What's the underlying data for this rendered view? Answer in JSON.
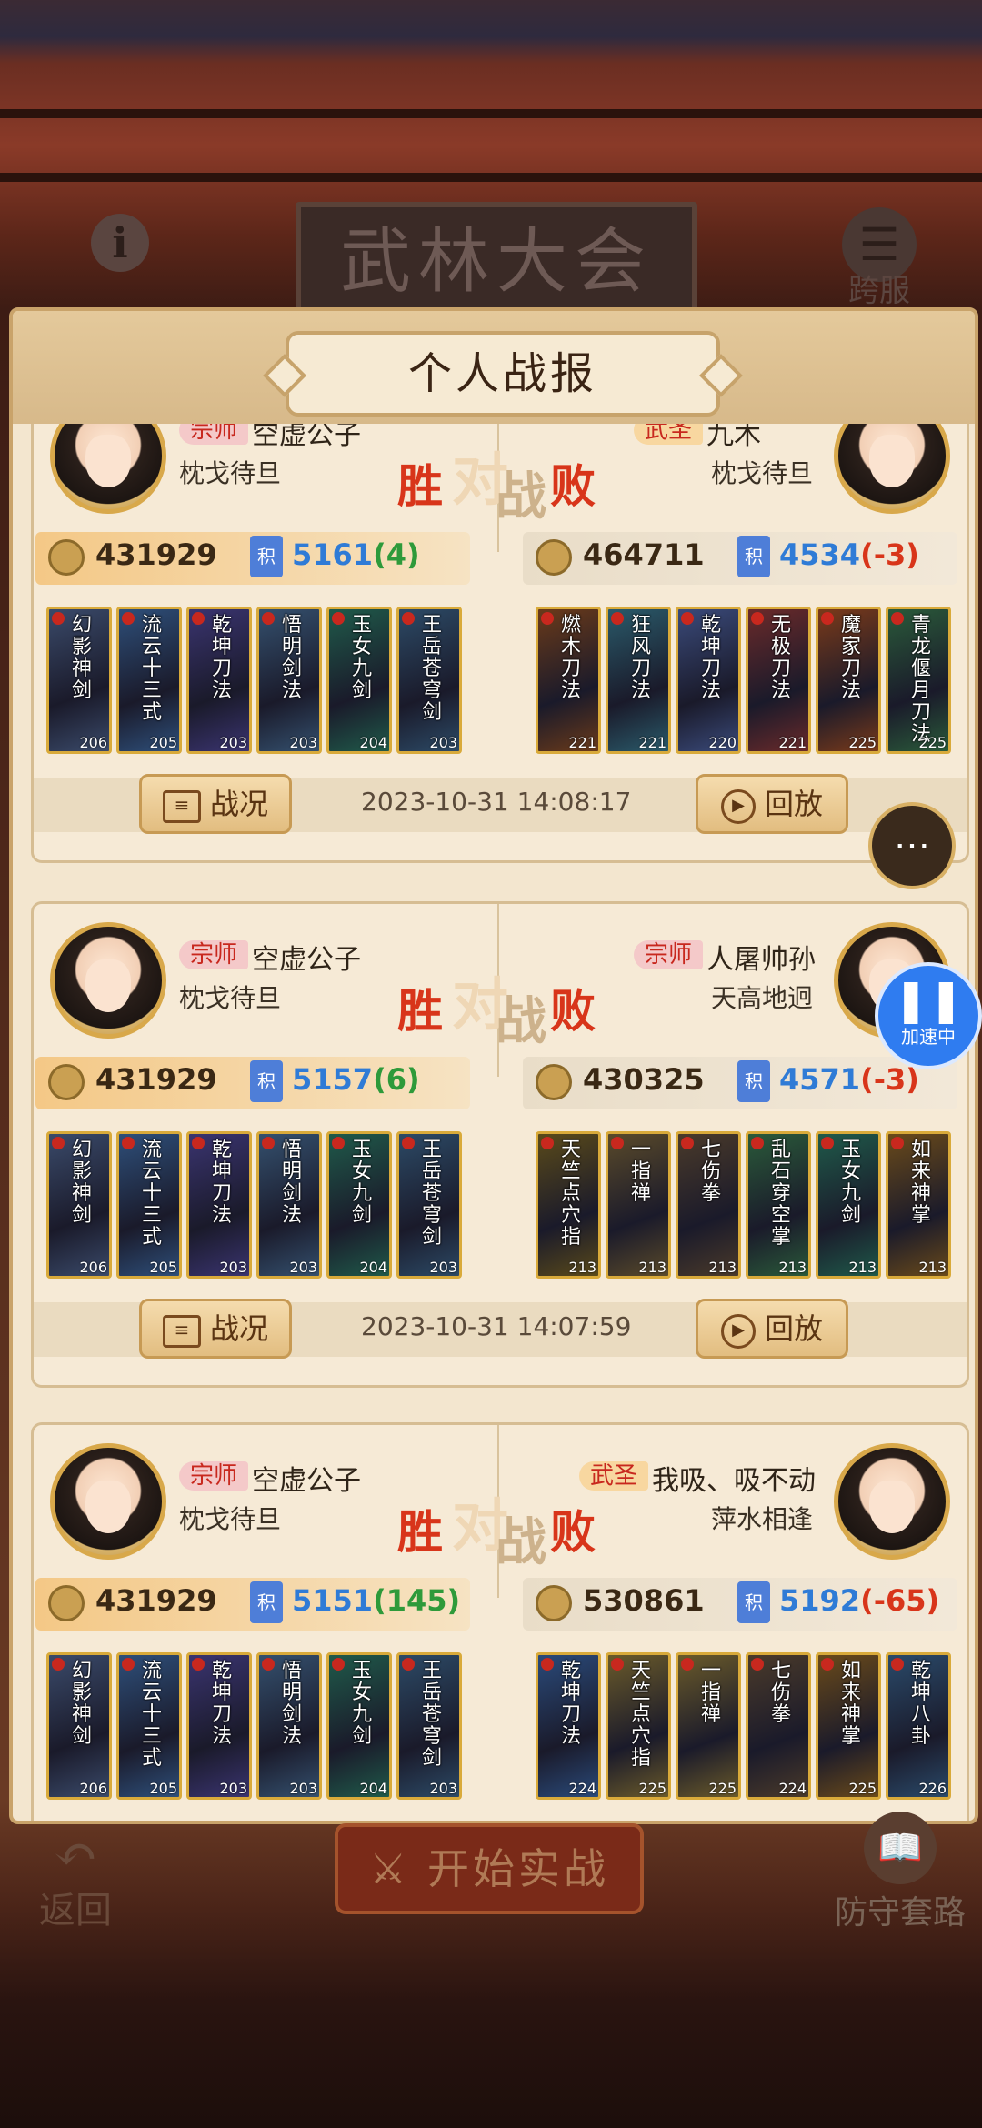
{
  "header": {
    "gate_title": "武林大会",
    "info_icon": "i",
    "server_label": "跨服"
  },
  "panel_title": "个人战报",
  "vs_text": {
    "win": "胜",
    "dui": "对",
    "zhan": "战",
    "lose": "败"
  },
  "footer_buttons": {
    "status": "战况",
    "replay": "回放"
  },
  "battles": [
    {
      "left": {
        "rank": "宗师",
        "name": "空虚公子",
        "guild": "枕戈待旦",
        "power": "431929",
        "score": "5161",
        "change": "(4)"
      },
      "right": {
        "rank": "武圣",
        "name": "九木",
        "guild": "枕戈待旦",
        "power": "464711",
        "score": "4534",
        "change": "(-3)"
      },
      "left_cards": [
        {
          "name": "幻影神剑",
          "lv": "206"
        },
        {
          "name": "流云十三式",
          "lv": "205"
        },
        {
          "name": "乾坤刀法",
          "lv": "203"
        },
        {
          "name": "悟明剑法",
          "lv": "203"
        },
        {
          "name": "玉女九剑",
          "lv": "204"
        },
        {
          "name": "王岳苍穹剑",
          "lv": "203"
        }
      ],
      "right_cards": [
        {
          "name": "燃木刀法",
          "lv": "221"
        },
        {
          "name": "狂风刀法",
          "lv": "221"
        },
        {
          "name": "乾坤刀法",
          "lv": "220"
        },
        {
          "name": "无极刀法",
          "lv": "221"
        },
        {
          "name": "魔家刀法",
          "lv": "225"
        },
        {
          "name": "青龙偃月刀法",
          "lv": "225"
        }
      ],
      "time": "2023-10-31 14:08:17"
    },
    {
      "left": {
        "rank": "宗师",
        "name": "空虚公子",
        "guild": "枕戈待旦",
        "power": "431929",
        "score": "5157",
        "change": "(6)"
      },
      "right": {
        "rank": "宗师",
        "name": "人屠帅孙",
        "guild": "天高地迥",
        "power": "430325",
        "score": "4571",
        "change": "(-3)"
      },
      "left_cards": [
        {
          "name": "幻影神剑",
          "lv": "206"
        },
        {
          "name": "流云十三式",
          "lv": "205"
        },
        {
          "name": "乾坤刀法",
          "lv": "203"
        },
        {
          "name": "悟明剑法",
          "lv": "203"
        },
        {
          "name": "玉女九剑",
          "lv": "204"
        },
        {
          "name": "王岳苍穹剑",
          "lv": "203"
        }
      ],
      "right_cards": [
        {
          "name": "天竺点穴指",
          "lv": "213"
        },
        {
          "name": "一指禅",
          "lv": "213"
        },
        {
          "name": "七伤拳",
          "lv": "213"
        },
        {
          "name": "乱石穿空掌",
          "lv": "213"
        },
        {
          "name": "玉女九剑",
          "lv": "213"
        },
        {
          "name": "如来神掌",
          "lv": "213"
        }
      ],
      "time": "2023-10-31 14:07:59"
    },
    {
      "left": {
        "rank": "宗师",
        "name": "空虚公子",
        "guild": "枕戈待旦",
        "power": "431929",
        "score": "5151",
        "change": "(145)"
      },
      "right": {
        "rank": "武圣",
        "name": "我吸、吸不动",
        "guild": "萍水相逢",
        "power": "530861",
        "score": "5192",
        "change": "(-65)"
      },
      "left_cards": [
        {
          "name": "幻影神剑",
          "lv": "206"
        },
        {
          "name": "流云十三式",
          "lv": "205"
        },
        {
          "name": "乾坤刀法",
          "lv": "203"
        },
        {
          "name": "悟明剑法",
          "lv": "203"
        },
        {
          "name": "玉女九剑",
          "lv": "204"
        },
        {
          "name": "王岳苍穹剑",
          "lv": "203"
        }
      ],
      "right_cards": [
        {
          "name": "乾坤刀法",
          "lv": "224"
        },
        {
          "name": "天竺点穴指",
          "lv": "225"
        },
        {
          "name": "一指禅",
          "lv": "225"
        },
        {
          "name": "七伤拳",
          "lv": "224"
        },
        {
          "name": "如来神掌",
          "lv": "225"
        },
        {
          "name": "乾坤八卦",
          "lv": "226"
        }
      ],
      "time": ""
    }
  ],
  "speed_button": {
    "icon": "pause",
    "label": "加速中"
  },
  "bottom": {
    "back_label": "返回",
    "start_label": "开始实战",
    "defense_label": "防守套路"
  },
  "colors": {
    "win": "#d8351a",
    "score_blue": "#2f7bd6",
    "positive": "#2e9a3a",
    "negative": "#d8351a"
  }
}
